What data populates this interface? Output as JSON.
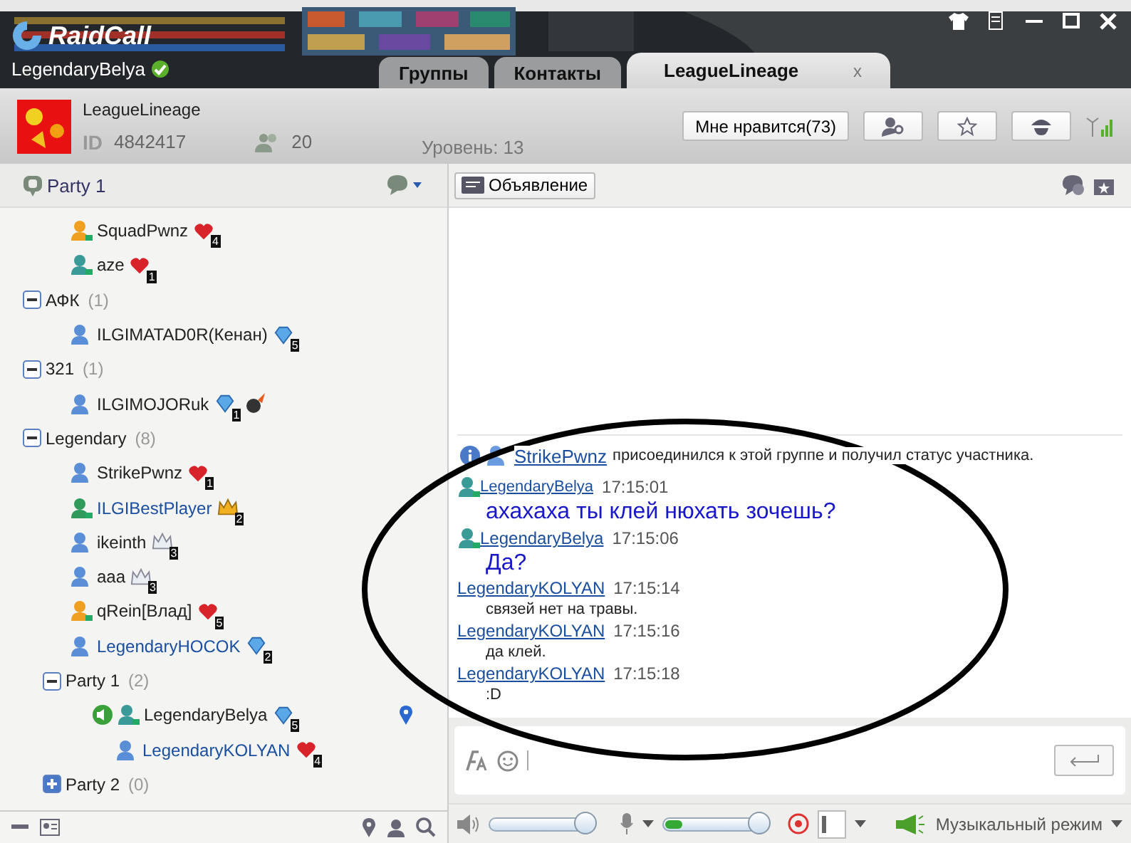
{
  "app": {
    "logo": "RaidCall",
    "user": "LegendaryBelya",
    "online": true
  },
  "tabs": [
    {
      "label": "Группы",
      "selected": false
    },
    {
      "label": "Контакты",
      "selected": false
    },
    {
      "label": "LeagueLineage",
      "selected": true,
      "close": "x"
    }
  ],
  "group": {
    "name": "LeagueLineage",
    "id_label": "ID",
    "id": "4842417",
    "members": "20",
    "level": "Уровень: 13",
    "like_button": "Мне нравится(73)"
  },
  "sidebar": {
    "title": "Party 1",
    "tree": [
      {
        "kind": "user",
        "name": "SquadPwnz",
        "color": "#f0a020",
        "member": true,
        "badge": {
          "kind": "heart",
          "count": "4"
        }
      },
      {
        "kind": "user",
        "name": "aze",
        "color": "#3a9a98",
        "member": true,
        "badge": {
          "kind": "heart",
          "count": "1"
        }
      },
      {
        "kind": "group",
        "label": "АФК",
        "count": "(1)",
        "expanded": true,
        "children": [
          {
            "kind": "user",
            "name": "ILGIMATAD0R(Кенан)",
            "color": "#5a8fd8",
            "member": false,
            "badge": {
              "kind": "diamond",
              "count": "5"
            }
          }
        ]
      },
      {
        "kind": "group",
        "label": "321",
        "count": "(1)",
        "expanded": true,
        "children": [
          {
            "kind": "user",
            "name": "ILGIMOJORuk",
            "color": "#5a8fd8",
            "member": false,
            "badge": {
              "kind": "diamond",
              "count": "1"
            },
            "extra_badge": true
          }
        ]
      },
      {
        "kind": "group",
        "label": "Legendary",
        "count": "(8)",
        "expanded": true,
        "children": [
          {
            "kind": "user",
            "name": "StrikePwnz",
            "color": "#5a8fd8",
            "member": false,
            "badge": {
              "kind": "heart",
              "count": "1"
            }
          },
          {
            "kind": "user",
            "name": "ILGIBestPlayer",
            "color": "#2f9a5a",
            "member": true,
            "highlighted": true,
            "badge": {
              "kind": "crown",
              "count": "2"
            }
          },
          {
            "kind": "user",
            "name": "ikeinth",
            "color": "#5a8fd8",
            "member": false,
            "badge": {
              "kind": "silver-crown",
              "count": "3"
            }
          },
          {
            "kind": "user",
            "name": "aaa",
            "color": "#5a8fd8",
            "member": false,
            "badge": {
              "kind": "silver-crown",
              "count": "3"
            }
          },
          {
            "kind": "user",
            "name": "qRein[Влад]",
            "color": "#f0a020",
            "member": true,
            "badge": {
              "kind": "heart",
              "count": "5"
            }
          },
          {
            "kind": "user",
            "name": "LegendaryHOCOK",
            "color": "#5a8fd8",
            "member": false,
            "highlighted": true,
            "badge": {
              "kind": "diamond",
              "count": "2"
            }
          },
          {
            "kind": "group",
            "label": "Party 1",
            "count": "(2)",
            "expanded": true,
            "children": [
              {
                "kind": "user",
                "name": "LegendaryBelya",
                "color": "#3a9a98",
                "member": true,
                "speaking": true,
                "pinned": true,
                "badge": {
                  "kind": "diamond",
                  "count": "5"
                },
                "children": [
                  {
                    "kind": "user",
                    "name": "LegendaryKOLYAN",
                    "color": "#5a8fd8",
                    "member": false,
                    "highlighted": true,
                    "badge": {
                      "kind": "heart",
                      "count": "4"
                    }
                  }
                ]
              }
            ]
          },
          {
            "kind": "group",
            "label": "Party 2",
            "count": "(0)",
            "expanded": false
          }
        ]
      }
    ]
  },
  "toolbar": {
    "announcement": "Объявление"
  },
  "chat": {
    "notice": {
      "user": "StrikePwnz",
      "text": "присоединился к этой группе и получил статус участника."
    },
    "messages": [
      {
        "sender": "LegendaryBelya",
        "time": "17:15:01",
        "text": "ахахаха ты клей нюхать зочешь?",
        "kind": "large",
        "avatar": true
      },
      {
        "sender": "LegendaryBelya",
        "time": "17:15:06",
        "text": "Да?",
        "kind": "large",
        "avatar": true
      },
      {
        "sender": "LegendaryKOLYAN",
        "time": "17:15:14",
        "text": "связей нет на травы.",
        "kind": "small",
        "avatar": false
      },
      {
        "sender": "LegendaryKOLYAN",
        "time": "17:15:16",
        "text": "да клей.",
        "kind": "small",
        "avatar": false
      },
      {
        "sender": "LegendaryKOLYAN",
        "time": "17:15:18",
        "text": ":D",
        "kind": "small",
        "avatar": false
      }
    ],
    "annotation": {
      "kind": "ellipse"
    }
  },
  "voice": {
    "speaker": {
      "level": 0.95
    },
    "mic": {
      "level": 0.95
    },
    "mic_meter": {
      "level": 0.17
    },
    "recording": true,
    "mode": "Музыкальный режим"
  }
}
